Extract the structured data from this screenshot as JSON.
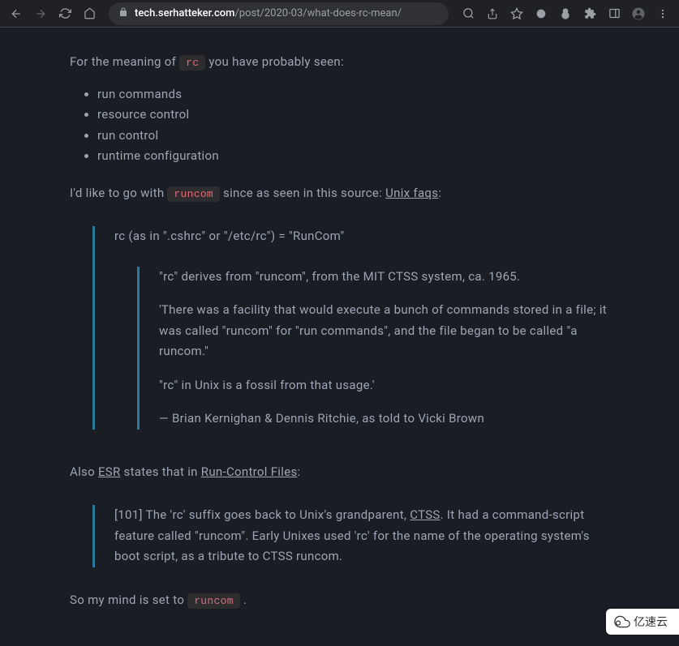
{
  "browser": {
    "url_domain": "tech.serhatteker.com",
    "url_path": "/post/2020-03/what-does-rc-mean/"
  },
  "article": {
    "p1_a": "For the meaning of ",
    "p1_code": "rc",
    "p1_b": " you have probably seen:",
    "meanings": [
      "run commands",
      "resource control",
      "run control",
      "runtime configuration"
    ],
    "p2_a": "I'd like to go with ",
    "p2_code": "runcom",
    "p2_b": " since as seen in this source: ",
    "p2_link": "Unix faqs",
    "p2_c": ":",
    "bq1_line1": "rc (as in \".cshrc\" or \"/etc/rc\") = \"RunCom\"",
    "bq1_inner1": "\"rc\" derives from \"runcom\", from the MIT CTSS system, ca. 1965.",
    "bq1_inner2": "'There was a facility that would execute a bunch of commands stored in a file; it was called \"runcom\" for \"run commands\", and the file began to be called \"a runcom.\"",
    "bq1_inner3": "\"rc\" in Unix is a fossil from that usage.'",
    "bq1_inner4": "— Brian Kernighan & Dennis Ritchie, as told to Vicki Brown",
    "p3_a": "Also ",
    "p3_link1": "ESR",
    "p3_b": " states that in ",
    "p3_link2": "Run-Control Files",
    "p3_c": ":",
    "bq2_a": "[101] The 'rc' suffix goes back to Unix's grandparent, ",
    "bq2_link": "CTSS",
    "bq2_b": ". It had a command-script feature called \"runcom\". Early Unixes used 'rc' for the name of the operating system's boot script, as a tribute to CTSS runcom.",
    "p4_a": "So my mind is set to ",
    "p4_code": "runcom",
    "p4_b": " ."
  },
  "watermark": {
    "text": "亿速云"
  }
}
